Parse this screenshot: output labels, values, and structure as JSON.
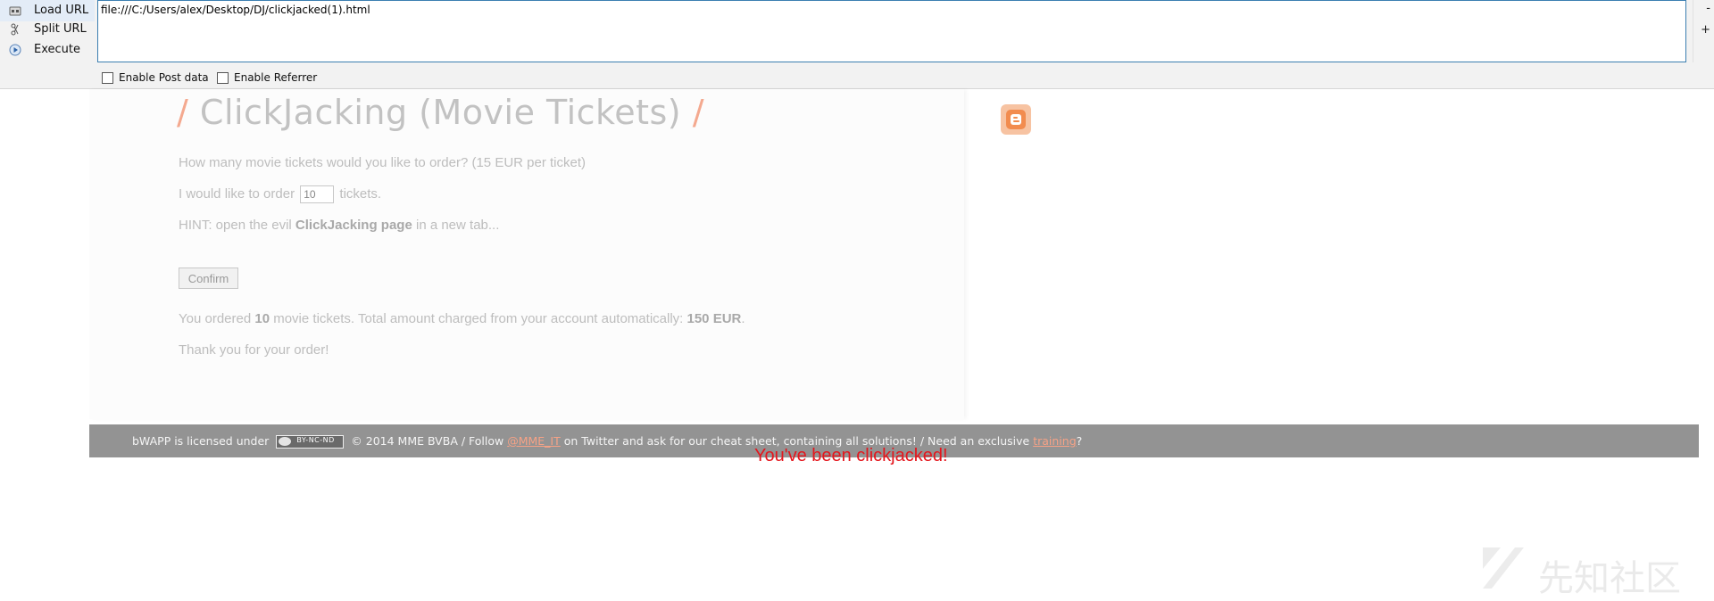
{
  "hackbar": {
    "buttons": [
      {
        "label": "Load URL",
        "icon": "load-url-icon"
      },
      {
        "label": "Split URL",
        "icon": "split-url-icon"
      },
      {
        "label": "Execute",
        "icon": "execute-icon"
      }
    ],
    "url": "file:///C:/Users/alex/Desktop/DJ/clickjacked(1).html",
    "side_minus": "-",
    "side_plus": "+",
    "enable_post_data": "Enable Post data",
    "enable_referrer": "Enable Referrer"
  },
  "page": {
    "title": "ClickJacking (Movie Tickets)",
    "title_slash": "/",
    "question": "How many movie tickets would you like to order? (15 EUR per ticket)",
    "order_prefix": "I would like to order",
    "order_value": "10",
    "order_suffix": "tickets.",
    "hint_prefix": "HINT: open the evil",
    "hint_bold": "ClickJacking page",
    "hint_suffix": "in a new tab...",
    "confirm_label": "Confirm",
    "result_prefix": "You ordered",
    "result_count": "10",
    "result_middle": "movie tickets. Total amount charged from your account automatically:",
    "result_amount": "150 EUR",
    "result_end": ".",
    "thanks": "Thank you for your order!"
  },
  "footer": {
    "licensed": "bWAPP is licensed under",
    "cc_badge": "BY-NC-ND",
    "follow": "© 2014 MME BVBA / Follow",
    "twitter_link": "@MME_IT",
    "twitter_rest": "on Twitter and ask for our cheat sheet, containing all solutions! / Need an exclusive",
    "training_link": "training",
    "question_mark": "?"
  },
  "overlay": {
    "clickjacked": "You've been clickjacked!"
  },
  "watermark": {
    "text": "先知社区"
  },
  "colors": {
    "accent_slash": "#f4a98f",
    "link": "#f6a286",
    "alert": "#e4161d"
  }
}
